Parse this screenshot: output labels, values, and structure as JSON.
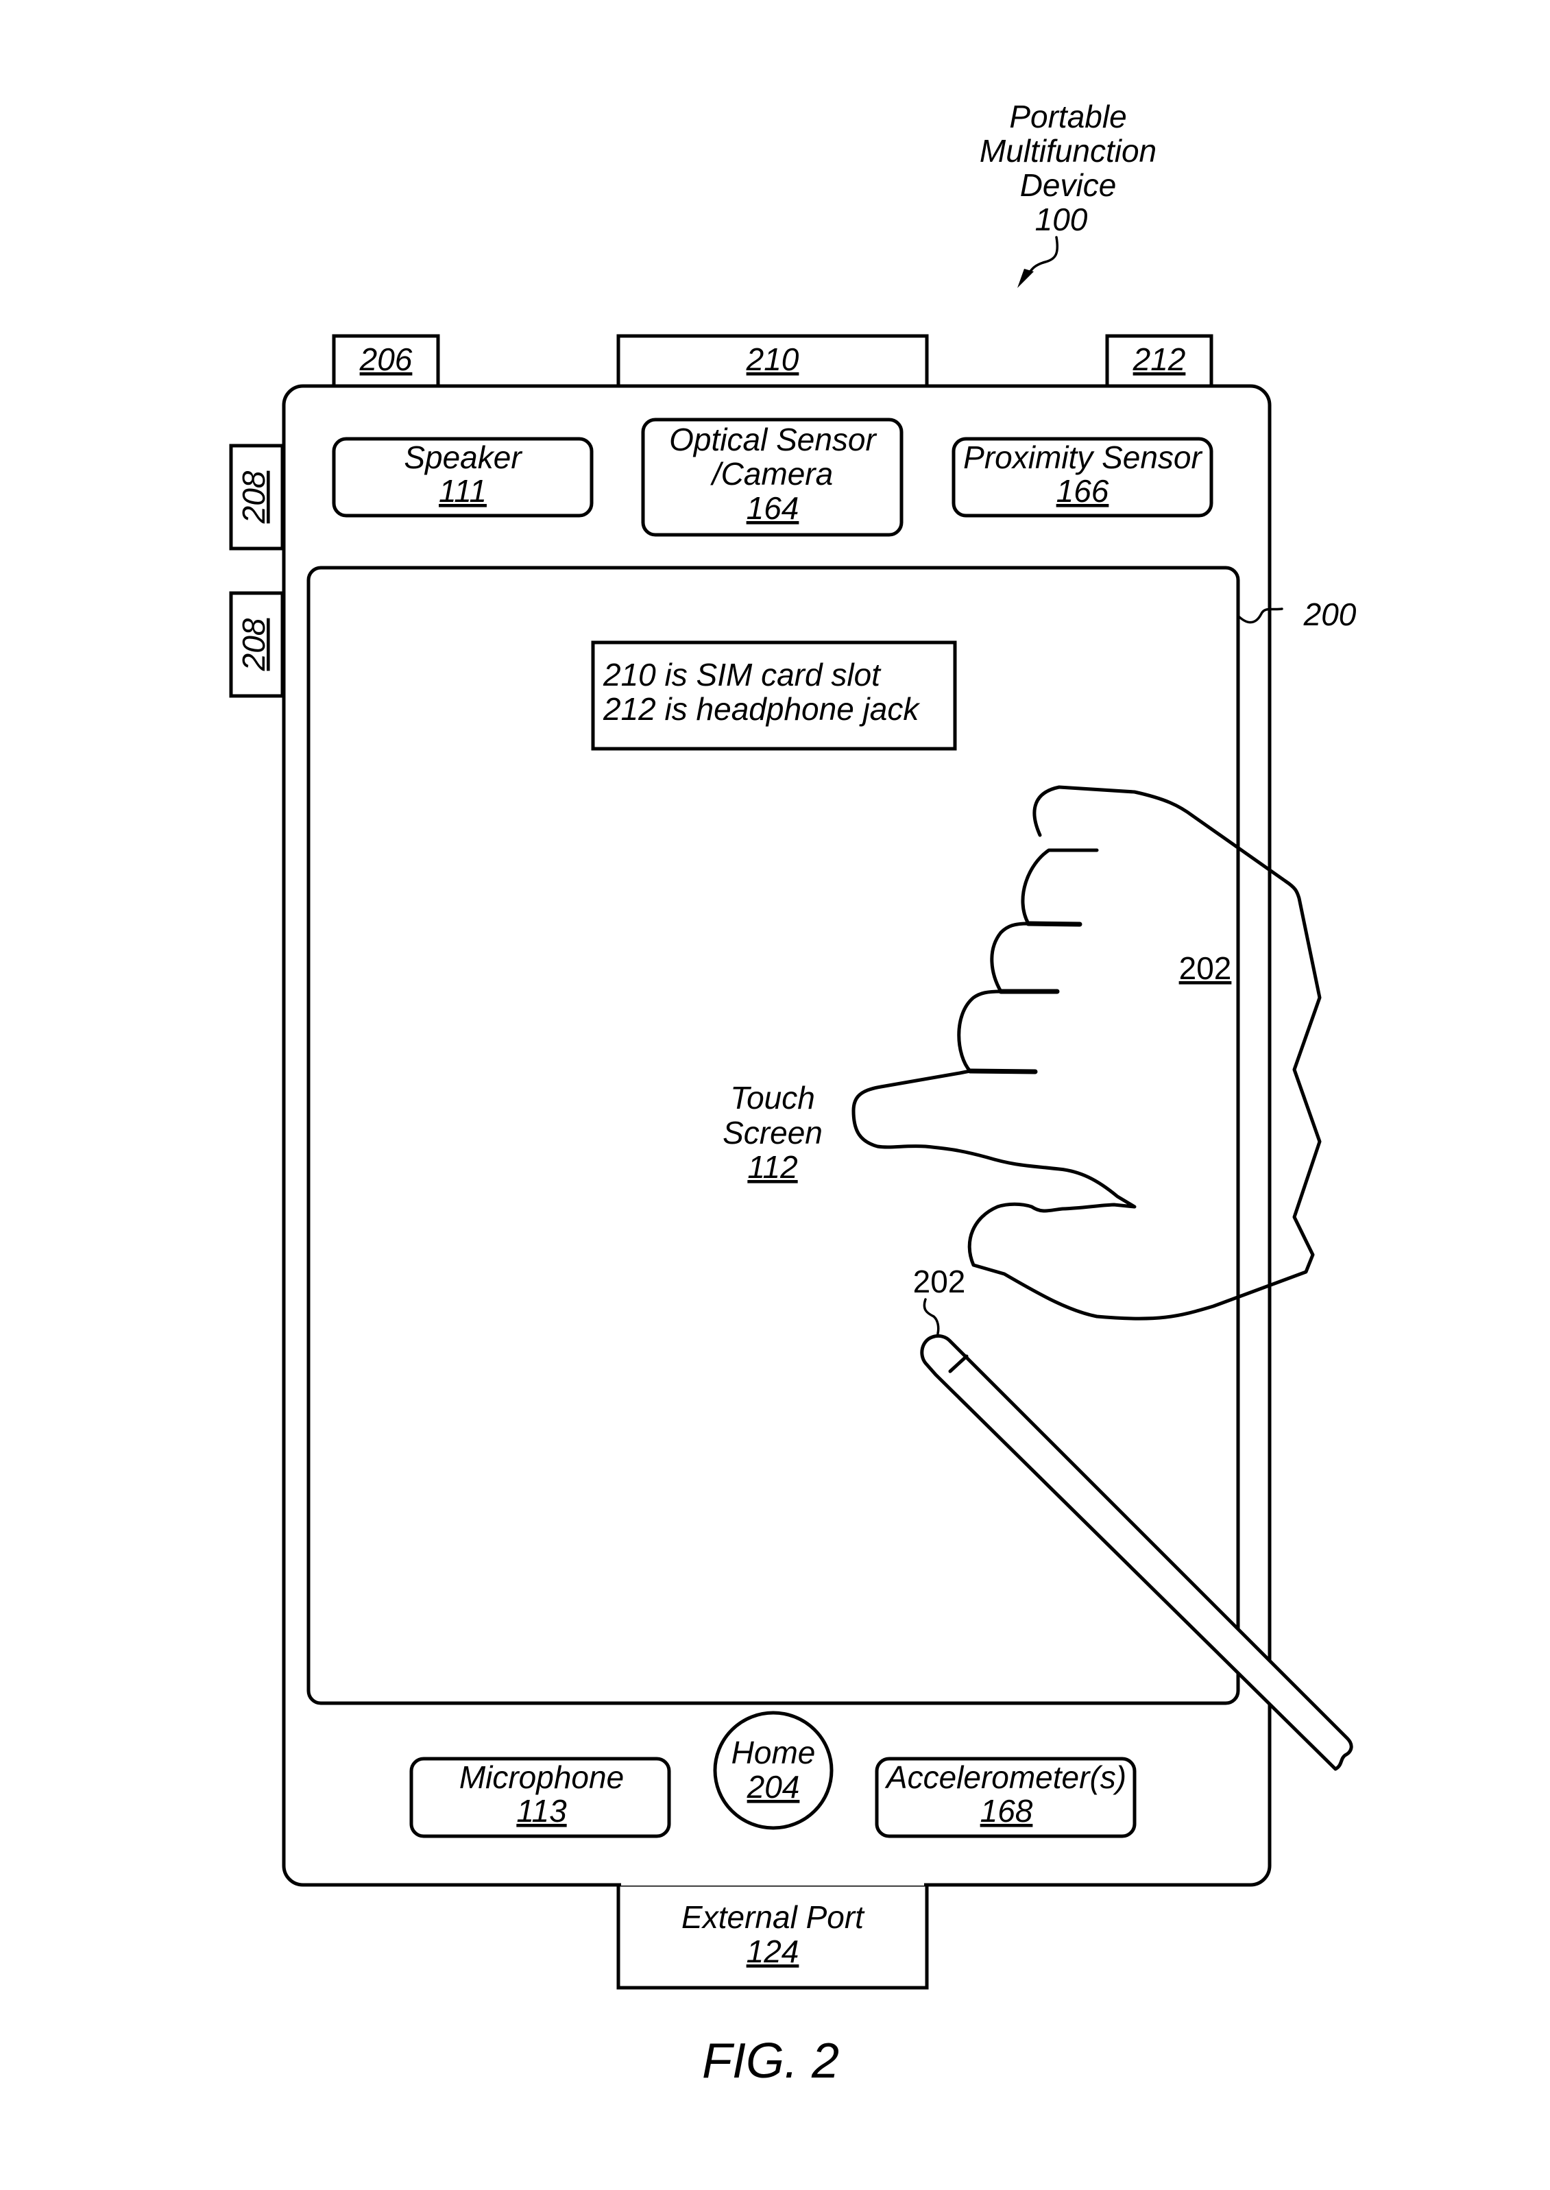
{
  "figure": {
    "caption": "FIG. 2",
    "device_title": [
      "Portable",
      "Multifunction",
      "Device"
    ],
    "device_ref": "100",
    "device_housing_ref": "200"
  },
  "top_ports": [
    {
      "ref": "206"
    },
    {
      "ref": "210"
    },
    {
      "ref": "212"
    }
  ],
  "side_buttons": [
    {
      "ref": "208"
    },
    {
      "ref": "208"
    }
  ],
  "top_components": [
    {
      "lines": [
        "Speaker"
      ],
      "ref": "111"
    },
    {
      "lines": [
        "Optical Sensor",
        "/Camera"
      ],
      "ref": "164"
    },
    {
      "lines": [
        "Proximity Sensor"
      ],
      "ref": "166"
    }
  ],
  "note": {
    "lines": [
      "210 is SIM card slot",
      "212 is headphone jack"
    ]
  },
  "touch_screen": {
    "lines": [
      "Touch",
      "Screen"
    ],
    "ref": "112"
  },
  "hand": {
    "ref": "202"
  },
  "stylus": {
    "ref": "202"
  },
  "bottom_components": [
    {
      "lines": [
        "Microphone"
      ],
      "ref": "113"
    },
    {
      "lines": [
        "Home"
      ],
      "ref": "204"
    },
    {
      "lines": [
        "Accelerometer(s)"
      ],
      "ref": "168"
    }
  ],
  "external_port": {
    "lines": [
      "External Port"
    ],
    "ref": "124"
  }
}
